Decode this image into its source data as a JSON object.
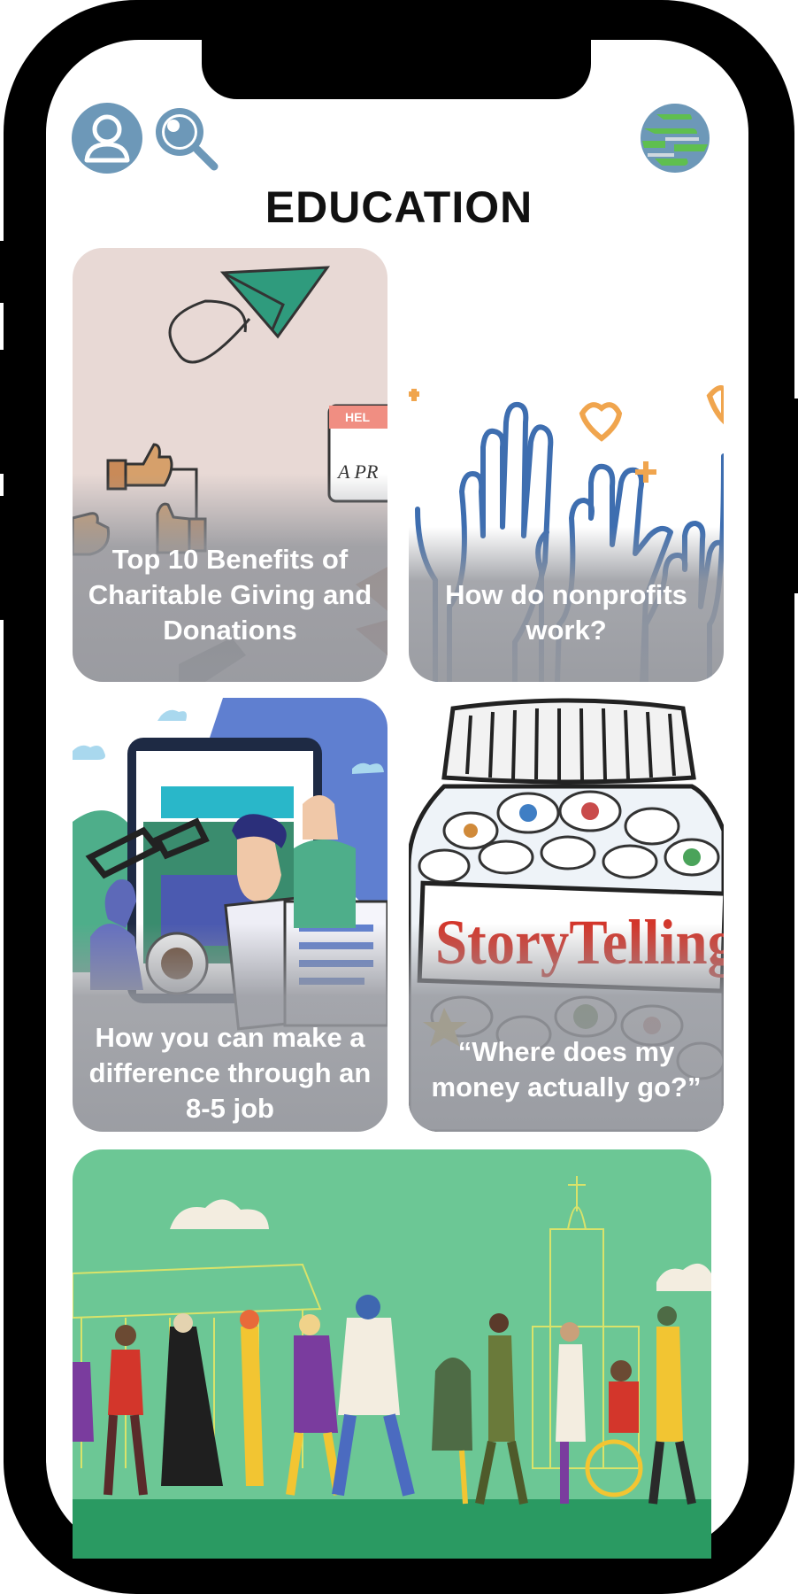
{
  "header": {
    "title": "EDUCATION",
    "icons": [
      "profile-icon",
      "search-icon",
      "globe-icon"
    ]
  },
  "cards": [
    {
      "title": "Top 10 Benefits of Charitable Giving and Donations"
    },
    {
      "title": "How do nonprofits work?"
    },
    {
      "title": "How you can make a difference through an 8-5 job"
    },
    {
      "title": "“Where does my money actually go?”"
    },
    {
      "title": ""
    }
  ],
  "artwork": {
    "card1_sign_text": "HEL",
    "card1_sign_text2": "A PR",
    "card4_jar_text": "StoryTelling"
  },
  "colors": {
    "accent": "#6d98b8",
    "card_overlay": "#96989e",
    "green_bg": "#6cc795"
  }
}
